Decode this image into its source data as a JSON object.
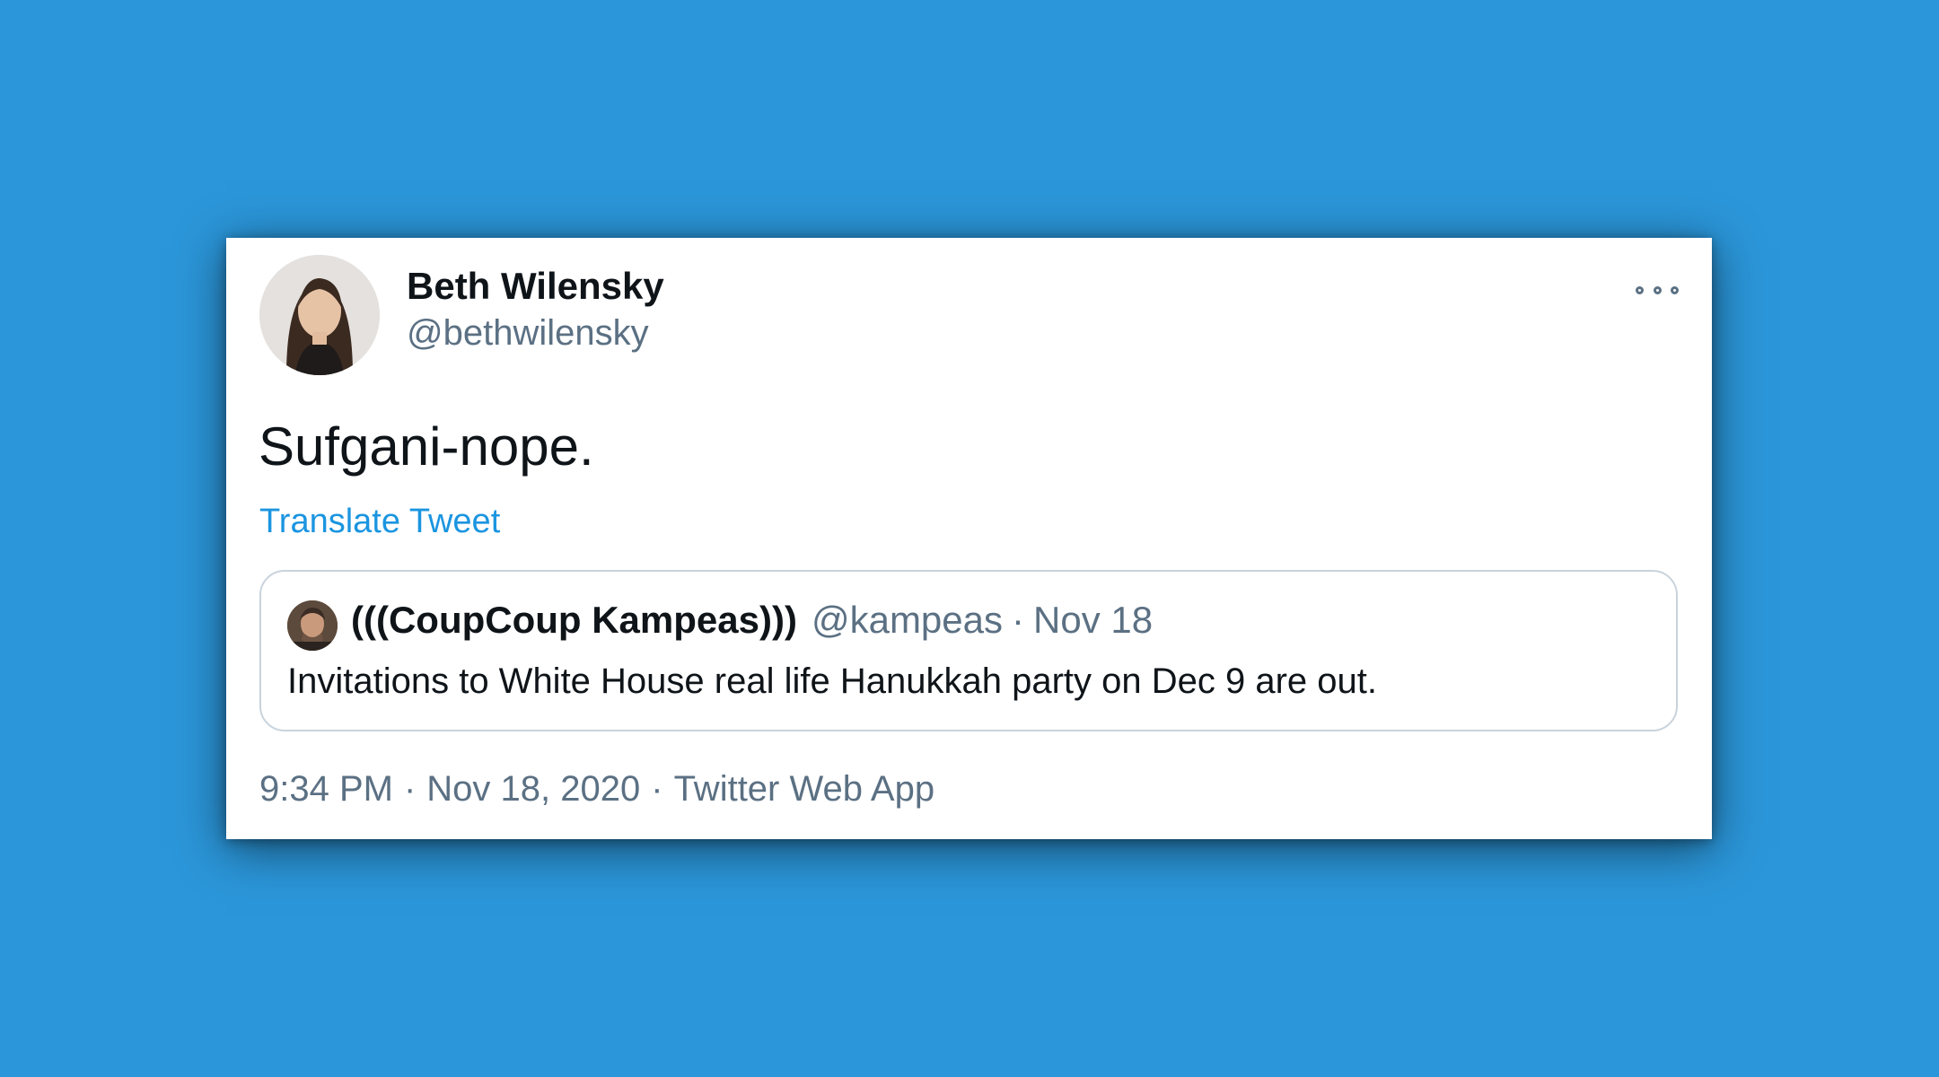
{
  "tweet": {
    "author_name": "Beth Wilensky",
    "author_handle": "@bethwilensky",
    "text": "Sufgani-nope.",
    "translate_label": "Translate Tweet",
    "more_icon": "more-options-icon",
    "time": "9:34 PM",
    "date": "Nov 18, 2020",
    "source": "Twitter Web App",
    "separator": "·"
  },
  "quote": {
    "author_name": "(((CoupCoup Kampeas)))",
    "author_handle": "@kampeas",
    "separator": "·",
    "date": "Nov 18",
    "text": "Invitations to White House real life Hanukkah party on Dec 9 are out."
  },
  "colors": {
    "background": "#2b96d9",
    "card": "#ffffff",
    "link": "#1b95e0",
    "secondary_text": "#5b7083",
    "primary_text": "#0f1419",
    "quote_border": "#c9d3dc"
  }
}
